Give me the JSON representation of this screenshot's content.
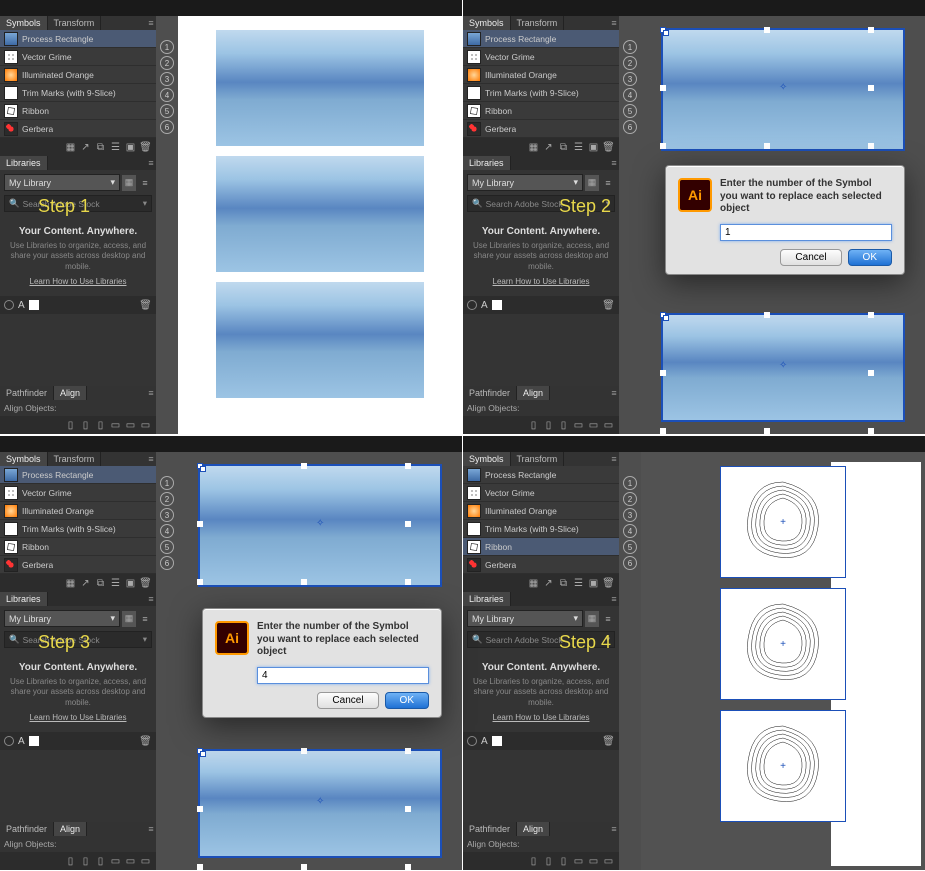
{
  "steps": {
    "s1": "Step 1",
    "s2": "Step 2",
    "s3": "Step 3",
    "s4": "Step 4"
  },
  "tabs": {
    "symbols": "Symbols",
    "transform": "Transform",
    "libraries": "Libraries",
    "pathfinder": "Pathfinder",
    "align": "Align"
  },
  "symbols": {
    "items": [
      {
        "name": "Process Rectangle"
      },
      {
        "name": "Vector Grime"
      },
      {
        "name": "Illuminated Orange"
      },
      {
        "name": "Trim Marks (with 9-Slice)"
      },
      {
        "name": "Ribbon"
      },
      {
        "name": "Gerbera"
      }
    ],
    "selected_step1": 0,
    "selected_step4": 4
  },
  "numbers": [
    "1",
    "2",
    "3",
    "4",
    "5",
    "6"
  ],
  "libraries": {
    "selector": "My Library",
    "search_placeholder": "Search Adobe Stock",
    "promo_title": "Your Content. Anywhere.",
    "promo_body": "Use Libraries to organize, access, and share your assets across desktop and mobile.",
    "promo_link": "Learn How to Use Libraries"
  },
  "align": {
    "label": "Align Objects:"
  },
  "dialog": {
    "icon_text": "Ai",
    "message": "Enter the number of the Symbol you want to replace each selected object",
    "value_step2": "1",
    "value_step3": "4",
    "cancel": "Cancel",
    "ok": "OK"
  }
}
